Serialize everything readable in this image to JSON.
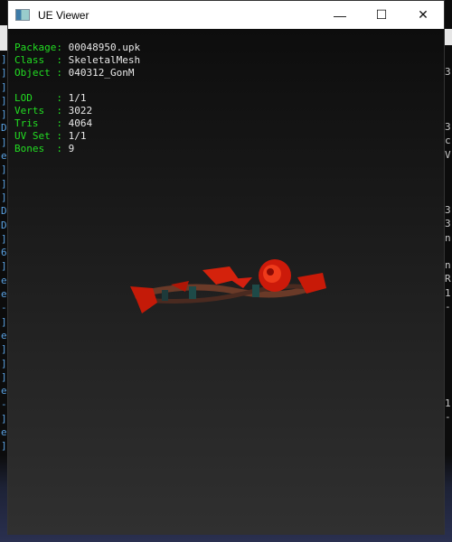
{
  "window": {
    "title": "UE Viewer",
    "minimize": "—",
    "maximize": "☐",
    "close": "✕"
  },
  "info": {
    "package": {
      "label": "Package:",
      "value": "00048950.upk"
    },
    "class": {
      "label": "Class  :",
      "value": "SkeletalMesh"
    },
    "object": {
      "label": "Object :",
      "value": "040312_GonM"
    },
    "lod": {
      "label": "LOD    :",
      "value": "1/1"
    },
    "verts": {
      "label": "Verts  :",
      "value": "3022"
    },
    "tris": {
      "label": "Tris   :",
      "value": "4064"
    },
    "uvset": {
      "label": "UV Set :",
      "value": "1/1"
    },
    "bones": {
      "label": "Bones  :",
      "value": "9"
    }
  },
  "background": {
    "left_column": "]\n]\n]\n]\n]\nD\n]\ne\n]\n]\n]\nD\nD\n]\n6\n]\ne\ne\n-\n]\ne\n]\n]\n]\ne\n-\n]\ne\n]",
    "right_column": "3\n\n\n\n3\nc\nV\n\n\n\n3\n3\nn\n\nn\nR\n1\n-\n\n\n\n\n\n\n1\n-"
  }
}
